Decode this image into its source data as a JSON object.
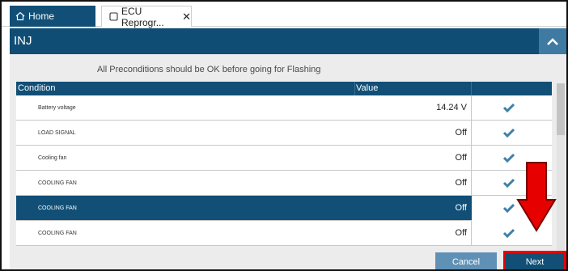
{
  "tabs": [
    {
      "label": "Home",
      "icon": "home-icon"
    },
    {
      "label": "ECU Reprogr...",
      "icon": "window-icon",
      "close": "✕"
    }
  ],
  "header": {
    "title": "INJ",
    "collapse_icon": "chevron-up-icon"
  },
  "notice": "All Preconditions should be OK before going for Flashing",
  "table": {
    "columns": [
      "Condition",
      "Value"
    ],
    "rows": [
      {
        "condition": "Battery voltage",
        "value": "14.24 V",
        "status": "check"
      },
      {
        "condition": "LOAD SIGNAL",
        "value": "Off",
        "status": "check"
      },
      {
        "condition": "Cooling fan",
        "value": "Off",
        "status": "check"
      },
      {
        "condition": "COOLING FAN",
        "value": "Off",
        "status": "check"
      },
      {
        "condition": "COOLING FAN",
        "value": "Off",
        "status": "check",
        "selected": true
      },
      {
        "condition": "COOLING FAN",
        "value": "Off",
        "status": "check"
      }
    ]
  },
  "buttons": {
    "cancel": "Cancel",
    "next": "Next"
  },
  "colors": {
    "primary": "#114f76",
    "accent": "#5f91b6",
    "check": "#3f7fab",
    "highlight": "#e60000"
  }
}
